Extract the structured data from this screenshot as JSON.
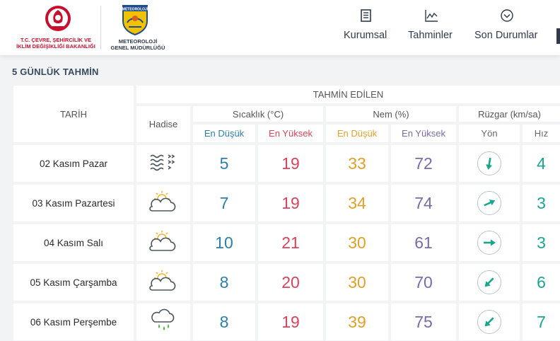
{
  "header": {
    "ministry_line1": "T.C. ÇEVRE, ŞEHİRCİLİK VE",
    "ministry_line2": "İKLİM DEĞİŞİKLİĞİ BAKANLIĞI",
    "mgm_logo_text": "METEOROLOJİ",
    "mgm_line1": "METEOROLOJİ",
    "mgm_line2": "GENEL MÜDÜRLÜĞÜ",
    "nav": [
      {
        "label": "Kurumsal",
        "icon": "document-icon"
      },
      {
        "label": "Tahminler",
        "icon": "chart-icon"
      },
      {
        "label": "Son Durumlar",
        "icon": "chevron-circle-icon"
      }
    ]
  },
  "section_title": "5 GÜNLÜK TAHMİN",
  "table": {
    "head": {
      "date": "TARİH",
      "predicted": "TAHMİN EDİLEN",
      "event": "Hadise",
      "temp": "Sıcaklık (°C)",
      "humidity": "Nem (%)",
      "wind": "Rüzgar (km/sa)",
      "min": "En Düşük",
      "max": "En Yüksek",
      "direction": "Yön",
      "speed": "Hız"
    },
    "rows": [
      {
        "date": "02 Kasım Pazar",
        "icon": "fog-icon",
        "temp_min": "5",
        "temp_max": "19",
        "hum_min": "33",
        "hum_max": "72",
        "wind_dir_deg": 190,
        "wind_speed": "4"
      },
      {
        "date": "03 Kasım Pazartesi",
        "icon": "partly-cloudy-icon",
        "temp_min": "7",
        "temp_max": "19",
        "hum_min": "34",
        "hum_max": "74",
        "wind_dir_deg": 65,
        "wind_speed": "3"
      },
      {
        "date": "04 Kasım Salı",
        "icon": "partly-cloudy-icon",
        "temp_min": "10",
        "temp_max": "21",
        "hum_min": "30",
        "hum_max": "61",
        "wind_dir_deg": 90,
        "wind_speed": "3"
      },
      {
        "date": "05 Kasım Çarşamba",
        "icon": "partly-cloudy-icon",
        "temp_min": "8",
        "temp_max": "20",
        "hum_min": "30",
        "hum_max": "70",
        "wind_dir_deg": 225,
        "wind_speed": "6"
      },
      {
        "date": "06 Kasım Perşembe",
        "icon": "rain-icon",
        "temp_min": "8",
        "temp_max": "19",
        "hum_min": "39",
        "hum_max": "75",
        "wind_dir_deg": 225,
        "wind_speed": "7"
      }
    ]
  }
}
